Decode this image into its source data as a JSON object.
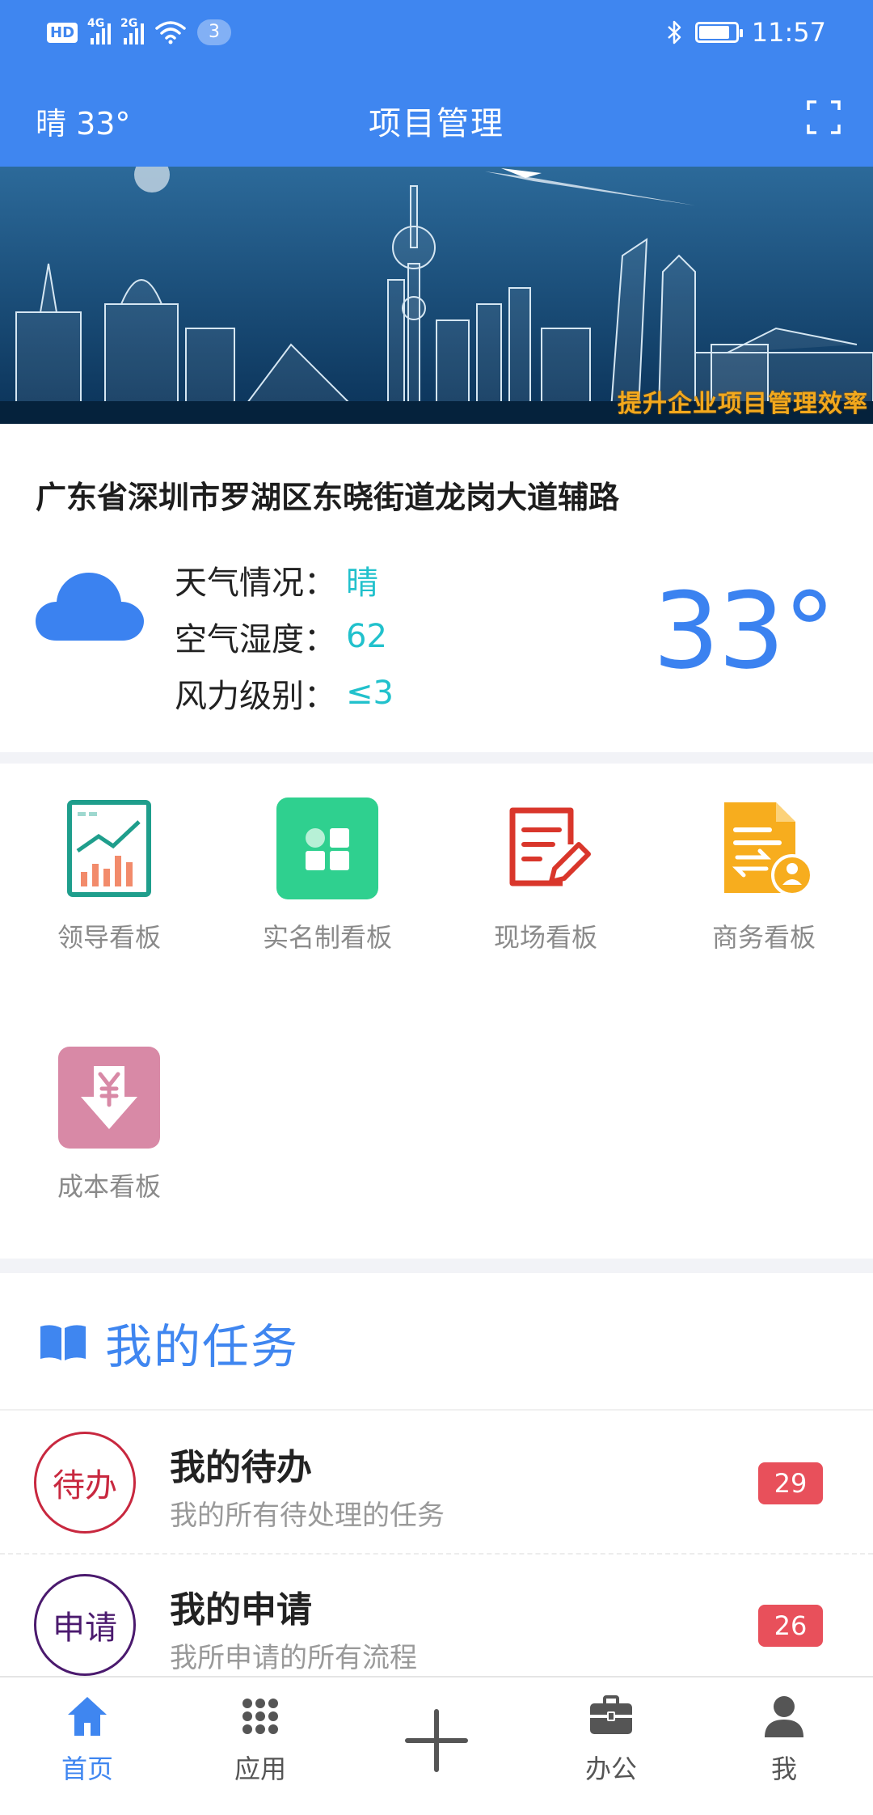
{
  "status_bar": {
    "hd": "HD",
    "sim1": "1",
    "net1": "4G",
    "net2": "2G",
    "notif_count": "3",
    "time": "11:57",
    "battery_level": 0.85
  },
  "navbar": {
    "weather": "晴 33°",
    "title": "项目管理",
    "expand_icon": "fullscreen-icon"
  },
  "banner": {
    "slogan": "提升企业项目管理效率"
  },
  "weather": {
    "address": "广东省深圳市罗湖区东晓街道龙岗大道辅路",
    "icon": "cloud-icon",
    "rows": [
      {
        "label": "天气情况：",
        "value": "晴"
      },
      {
        "label": "空气湿度：",
        "value": "62"
      },
      {
        "label": "风力级别：",
        "value": "≤3"
      }
    ],
    "temperature": "33°",
    "accent": "#3b82f0",
    "value_color": "#21c1cc"
  },
  "boards": [
    {
      "label": "领导看板",
      "icon": "leader-chart-icon",
      "color": "#1f9e8c"
    },
    {
      "label": "实名制看板",
      "icon": "grid-apps-icon",
      "color": "#2fd08f"
    },
    {
      "label": "现场看板",
      "icon": "edit-document-icon",
      "color": "#d9362b"
    },
    {
      "label": "商务看板",
      "icon": "business-doc-icon",
      "color": "#f7ad1e"
    },
    {
      "label": "成本看板",
      "icon": "yen-download-icon",
      "color": "#d889a6"
    }
  ],
  "tasks": {
    "title": "我的任务",
    "icon": "book-icon",
    "items": [
      {
        "badge": "待办",
        "title": "我的待办",
        "desc": "我的所有待处理的任务",
        "count": "29",
        "badge_color": "#c8283f"
      },
      {
        "badge": "申请",
        "title": "我的申请",
        "desc": "我所申请的所有流程",
        "count": "26",
        "badge_color": "#4b1a6e"
      }
    ]
  },
  "tabbar": {
    "tabs": [
      {
        "label": "首页",
        "icon": "home-icon",
        "active": true
      },
      {
        "label": "应用",
        "icon": "apps-grid-icon",
        "active": false
      },
      {
        "label": "",
        "icon": "plus-icon",
        "active": false
      },
      {
        "label": "办公",
        "icon": "briefcase-icon",
        "active": false
      },
      {
        "label": "我",
        "icon": "user-icon",
        "active": false
      }
    ]
  }
}
